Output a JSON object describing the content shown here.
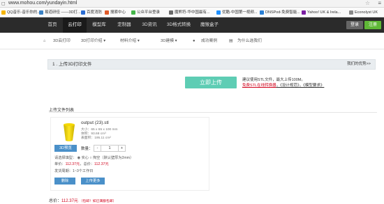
{
  "browser": {
    "url": "www.mohou.com/yundayin.html",
    "bookmarks": [
      {
        "label": "QQ音乐-音乐你的..",
        "color": "#f4b400"
      },
      {
        "label": "易道研佳 ——3D打...",
        "color": "#3b82c4"
      },
      {
        "label": "百度消防",
        "color": "#2b6dd3"
      },
      {
        "label": "搜索中心",
        "color": "#e05b2a"
      },
      {
        "label": "公众平台登录",
        "color": "#44b549"
      },
      {
        "label": "魔熊符-华中国最有...",
        "color": "#6a6a6a"
      },
      {
        "label": "优酷-中国第一视频...",
        "color": "#1e90ff"
      },
      {
        "label": "DNSPod-免费智能...",
        "color": "#2a7fd4"
      },
      {
        "label": "Yahoo! UK & Irela...",
        "color": "#7b1fa2"
      },
      {
        "label": "Econolyst UK",
        "color": "#888888"
      }
    ]
  },
  "nav": {
    "items": [
      "首页",
      "云打印",
      "模型库",
      "定制器",
      "3D资讯",
      "3D格式转换",
      "魔猴盒子"
    ],
    "login": "登录",
    "register": "注册"
  },
  "subnav": {
    "items": [
      "3D云打印",
      "3D打印介绍",
      "材料介绍",
      "3D建模",
      "成功案例",
      "为什么选我们"
    ]
  },
  "step": {
    "title": "1 . 上传3D打印文件",
    "advantage": "我们的优势>>"
  },
  "upload": {
    "button": "立即上传",
    "hint1": "建议使用STL文件，最大上传100M。",
    "hint2_red": "免费STL在线转换器",
    "hint2_mid": "，《设计规范》",
    "hint2_end": "，《模型要求》"
  },
  "list": {
    "title": "上传文件列表",
    "file": {
      "name": "output (23).stl",
      "size": "大小：65 x 65 x 100  mm",
      "volume": "体积：93.68 cm³",
      "area": "表面积：195.11 cm²",
      "btn3d": "3D预览",
      "qty_label": "数量：",
      "qty": "1",
      "minus": "-",
      "plus": "+",
      "fill_label": "请选择填型：",
      "fill_opt1": "实心",
      "fill_opt2": "掏空（默认壁厚为2mm）",
      "price_label": "单价：",
      "price": "112.37元",
      "subtotal_label": "，总价：",
      "subtotal": "112.37元",
      "shipping": "发货周期：1~3个工作日",
      "delete": "删除",
      "upload_more": "上传更多"
    }
  },
  "total": {
    "label": "总价：",
    "value": "112.37元",
    "note": "（包邮！如已满额包邮）"
  }
}
